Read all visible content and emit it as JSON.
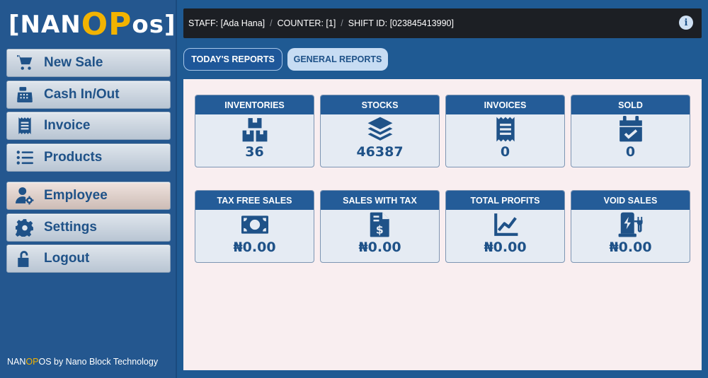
{
  "brand": {
    "logo_left": "[NAN",
    "logo_mid": "OP",
    "logo_right": "os]",
    "accent": "#f2b300",
    "footer_left": "NAN",
    "footer_mid": "OP",
    "footer_right": "OS by Nano Block Technology"
  },
  "sidebar": {
    "items": [
      {
        "label": "New Sale",
        "icon": "cart-icon"
      },
      {
        "label": "Cash In/Out",
        "icon": "cash-register-icon"
      },
      {
        "label": "Invoice",
        "icon": "receipt-icon"
      },
      {
        "label": "Products",
        "icon": "list-icon"
      },
      {
        "label": "Employee",
        "icon": "user-gear-icon"
      },
      {
        "label": "Settings",
        "icon": "gear-icon"
      },
      {
        "label": "Logout",
        "icon": "unlock-icon"
      }
    ]
  },
  "topbar": {
    "staff": "STAFF: [Ada Hana]",
    "counter": "COUNTER: [1]",
    "shift": "SHIFT ID: [023845413990]",
    "separator": "/"
  },
  "tabs": {
    "today": "TODAY'S REPORTS",
    "general": "GENERAL REPORTS"
  },
  "cards": [
    {
      "title": "INVENTORIES",
      "value": "36",
      "icon": "boxes-icon"
    },
    {
      "title": "STOCKS",
      "value": "46387",
      "icon": "layers-icon"
    },
    {
      "title": "INVOICES",
      "value": "0",
      "icon": "receipt-icon"
    },
    {
      "title": "SOLD",
      "value": "0",
      "icon": "calendar-check-icon"
    },
    {
      "title": "TAX FREE SALES",
      "value": "₦0.00",
      "icon": "money-bill-icon"
    },
    {
      "title": "SALES WITH TAX",
      "value": "₦0.00",
      "icon": "file-invoice-dollar-icon"
    },
    {
      "title": "TOTAL PROFITS",
      "value": "₦0.00",
      "icon": "chart-line-icon"
    },
    {
      "title": "VOID SALES",
      "value": "₦0.00",
      "icon": "charging-station-icon"
    }
  ]
}
